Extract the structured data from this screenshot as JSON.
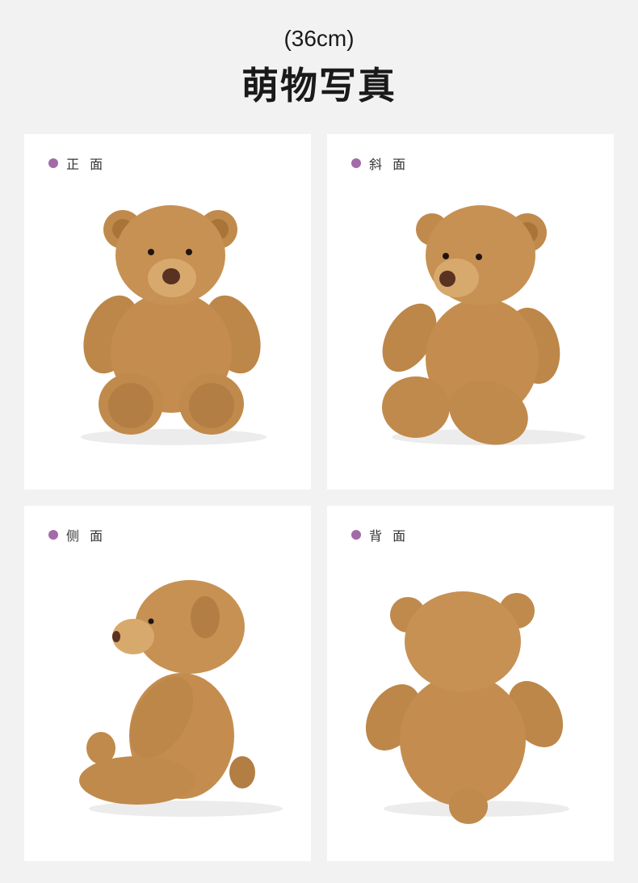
{
  "header": {
    "size": "(36cm)",
    "title": "萌物写真"
  },
  "accent_color": "#a26ba8",
  "views": [
    {
      "label": "正 面",
      "icon": "bullet-dot"
    },
    {
      "label": "斜 面",
      "icon": "bullet-dot"
    },
    {
      "label": "侧 面",
      "icon": "bullet-dot"
    },
    {
      "label": "背 面",
      "icon": "bullet-dot"
    }
  ]
}
